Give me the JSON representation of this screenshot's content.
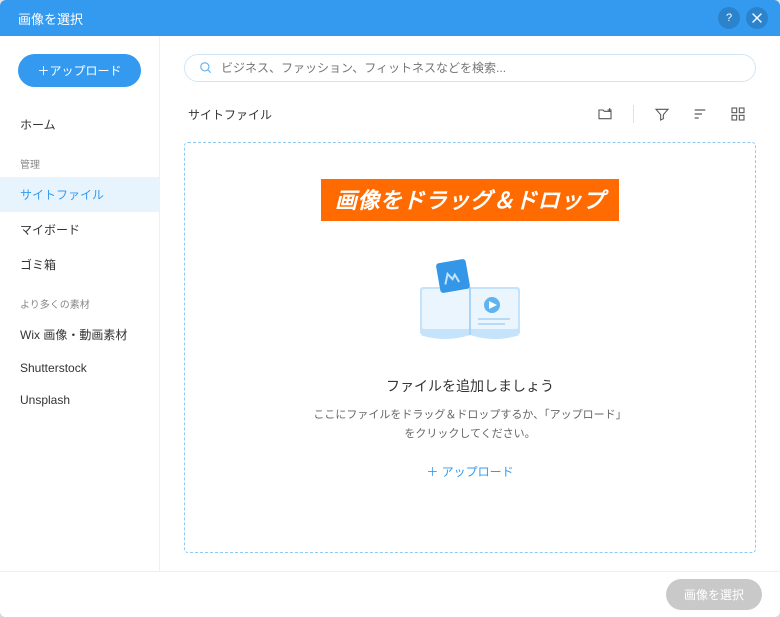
{
  "titlebar": {
    "title": "画像を選択"
  },
  "sidebar": {
    "upload_label": "＋アップロード",
    "home_label": "ホーム",
    "section_manage": "管理",
    "items_manage": [
      {
        "label": "サイトファイル"
      },
      {
        "label": "マイボード"
      },
      {
        "label": "ゴミ箱"
      }
    ],
    "section_more": "より多くの素材",
    "items_more": [
      {
        "label": "Wix 画像・動画素材"
      },
      {
        "label": "Shutterstock"
      },
      {
        "label": "Unsplash"
      }
    ]
  },
  "search": {
    "placeholder": "ビジネス、ファッション、フィットネスなどを検索..."
  },
  "main": {
    "header_title": "サイトファイル"
  },
  "dropzone": {
    "banner": "画像をドラッグ＆ドロップ",
    "title": "ファイルを追加しましょう",
    "subtitle": "ここにファイルをドラッグ＆ドロップするか、「アップロード」をクリックしてください。",
    "upload_label": "＋ アップロード"
  },
  "footer": {
    "select_label": "画像を選択"
  }
}
